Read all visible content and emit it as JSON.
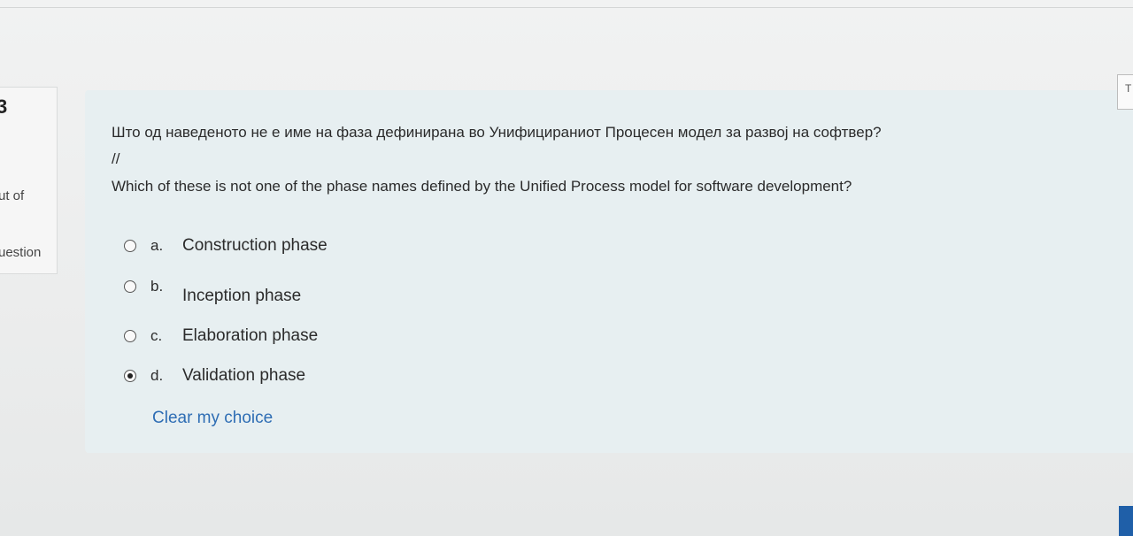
{
  "sidebar": {
    "question_number": "3",
    "text1": "ut of",
    "text2": "uestion"
  },
  "question": {
    "line_mk": "Што од наведеното не е име на фаза дефинирана во Унифицираниот Процесен модел за развој на софтвер?",
    "separator": "//",
    "line_en": "Which of these is not one of the phase names defined by the Unified Process model for software development?"
  },
  "answers": [
    {
      "letter": "a.",
      "text": "Construction phase",
      "selected": false
    },
    {
      "letter": "b.",
      "text": "Inception phase",
      "selected": false
    },
    {
      "letter": "c.",
      "text": "Elaboration phase",
      "selected": false
    },
    {
      "letter": "d.",
      "text": "Validation phase",
      "selected": true
    }
  ],
  "clear_choice_label": "Clear my choice",
  "right_box_char": "T"
}
